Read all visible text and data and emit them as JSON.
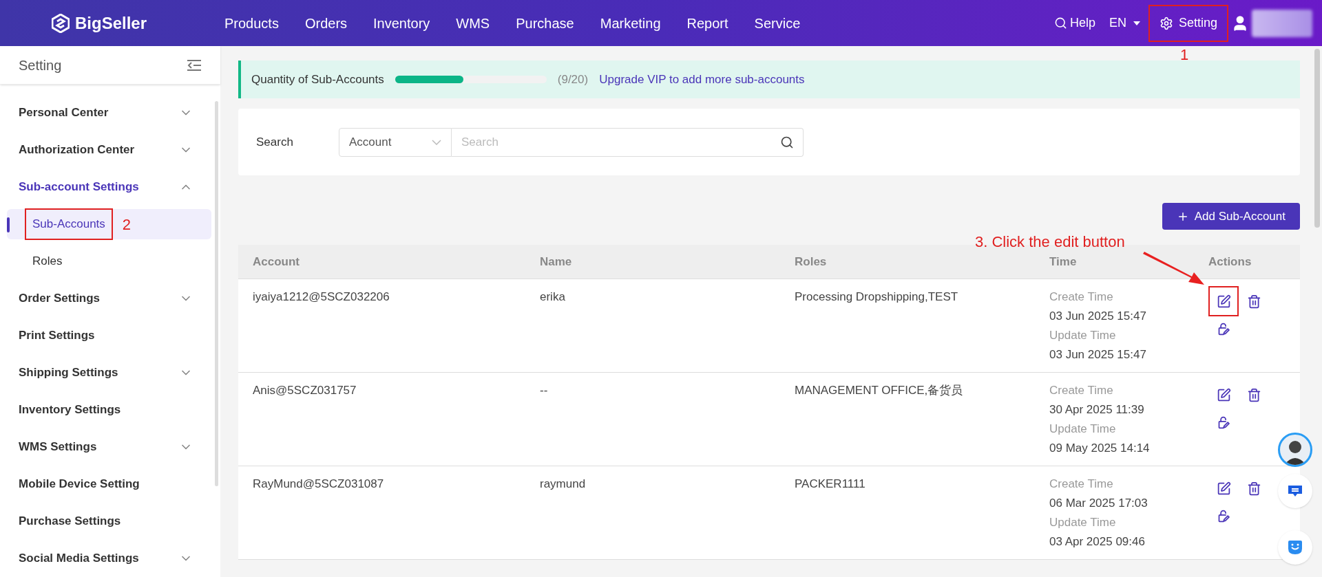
{
  "header": {
    "logo": "BigSeller",
    "nav": [
      {
        "label": "Products"
      },
      {
        "label": "Orders"
      },
      {
        "label": "Inventory"
      },
      {
        "label": "WMS"
      },
      {
        "label": "Purchase"
      },
      {
        "label": "Marketing"
      },
      {
        "label": "Report"
      },
      {
        "label": "Service"
      }
    ],
    "help": "Help",
    "language": "EN",
    "setting": {
      "label": "Setting",
      "highlighted": true
    }
  },
  "sidebar": {
    "title": "Setting",
    "items": [
      {
        "kind": "group",
        "label": "Personal Center",
        "expanded": false
      },
      {
        "kind": "group",
        "label": "Authorization Center",
        "expanded": false
      },
      {
        "kind": "group",
        "label": "Sub-account Settings",
        "expanded": true,
        "children": [
          {
            "label": "Sub-Accounts",
            "selected": true,
            "highlighted": true
          },
          {
            "label": "Roles",
            "selected": false,
            "highlighted": false
          }
        ]
      },
      {
        "kind": "group",
        "label": "Order Settings",
        "expanded": false
      },
      {
        "kind": "link",
        "label": "Print Settings"
      },
      {
        "kind": "group",
        "label": "Shipping Settings",
        "expanded": false
      },
      {
        "kind": "link",
        "label": "Inventory Settings"
      },
      {
        "kind": "group",
        "label": "WMS Settings",
        "expanded": false
      },
      {
        "kind": "link",
        "label": "Mobile Device Setting"
      },
      {
        "kind": "link",
        "label": "Purchase Settings"
      },
      {
        "kind": "group",
        "label": "Social Media Settings",
        "expanded": false
      }
    ]
  },
  "quota": {
    "label": "Quantity of Sub-Accounts",
    "level": 0.45,
    "count": "(9/20)",
    "link": "Upgrade VIP to add more sub-accounts"
  },
  "search": {
    "label": "Search",
    "field": "Account",
    "placeholder": "Search"
  },
  "add_button": "Add Sub-Account",
  "table": {
    "columns": [
      "Account",
      "Name",
      "Roles",
      "Time",
      "Actions"
    ],
    "rows": [
      {
        "account": "iyaiya1212@5SCZ032206",
        "name": "erika",
        "roles": "Processing Dropshipping,TEST",
        "create_label": "Create Time",
        "create_time": "03 Jun 2025 15:47",
        "update_label": "Update Time",
        "update_time": "03 Jun 2025 15:47",
        "edit_highlighted": true
      },
      {
        "account": "Anis@5SCZ031757",
        "name": "--",
        "roles": "MANAGEMENT OFFICE,备货员",
        "create_label": "Create Time",
        "create_time": "30 Apr 2025 11:39",
        "update_label": "Update Time",
        "update_time": "09 May 2025 14:14",
        "edit_highlighted": false
      },
      {
        "account": "RayMund@5SCZ031087",
        "name": "raymund",
        "roles": "PACKER1111",
        "create_label": "Create Time",
        "create_time": "06 Mar 2025 17:03",
        "update_label": "Update Time",
        "update_time": "03 Apr 2025 09:46",
        "edit_highlighted": false
      }
    ]
  },
  "annotations": {
    "step_1": "1",
    "step_2": "2",
    "step_3": "3. Click the edit button"
  }
}
